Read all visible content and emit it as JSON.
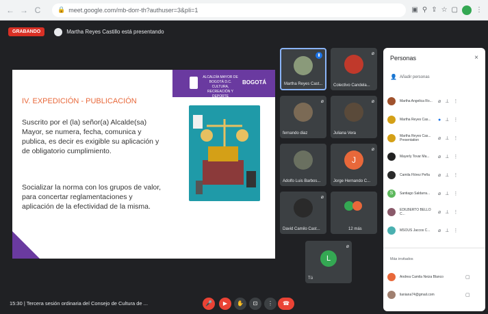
{
  "browser": {
    "url": "meet.google.com/mb-dorr-th?authuser=3&pli=1",
    "nav_back": "←",
    "nav_forward": "→",
    "nav_reload": "C",
    "lock": "🔒"
  },
  "meet": {
    "recording_label": "GRABANDO",
    "presenting_text": "Martha Reyes Castillo está presentando"
  },
  "slide": {
    "title": "IV. EXPEDICIÓN - PUBLICACIÓN",
    "paragraph1": "Suscrito por el (la) señor(a) Alcalde(sa) Mayor, se numera, fecha, comunica y publica, es decir es exigible su aplicación y de obligatorio cumplimiento.",
    "paragraph2": "Socializar la norma con los grupos de valor, para concertar reglamentaciones y aplicación de la efectividad de la misma.",
    "logo_text": "ALCALDÍA MAYOR DE BOGOTÁ D.C. CULTURA, RECREACIÓN Y DEPORTE",
    "logo_bogota": "BOGOTÁ"
  },
  "tiles": [
    {
      "name": "Martha Reyes Cast...",
      "avatar_color": "#8a9a7a"
    },
    {
      "name": "Colectivo Candela...",
      "avatar_color": "#c0392b"
    },
    {
      "name": "fernando diaz",
      "avatar_color": "#7b6a55"
    },
    {
      "name": "Juliana Vera",
      "avatar_color": "#5a4a3a"
    },
    {
      "name": "Adolfo Luis Barbos...",
      "avatar_color": "#6a7060"
    },
    {
      "name": "Jorge Hernando C...",
      "avatar_color": "#e8683a",
      "initial": "J"
    },
    {
      "name": "David Camilo Cast...",
      "avatar_color": "#2a2a2a"
    },
    {
      "name": "12 más",
      "avatar_color": "#e8683a"
    },
    {
      "name": "Tú",
      "avatar_color": "#34a853",
      "initial": "L"
    }
  ],
  "bottom": {
    "meeting_info": "15:30  |  Tercera sesión ordinaria del Consejo de Cultura de ..."
  },
  "panel": {
    "title": "Personas",
    "close": "×",
    "add_people": "Añadir personas",
    "in_call_label": "",
    "invited_label": "Más invitados",
    "people": [
      {
        "name": "Martha Angelica Ro...",
        "color": "#a0522d"
      },
      {
        "name": "Martha Reyes Cas...",
        "color": "#d4a017"
      },
      {
        "name": "Martha Reyes Cas... Presentation",
        "color": "#d4a017"
      },
      {
        "name": "Mayerly Tovar Ma...",
        "color": "#222222"
      },
      {
        "name": "Camila Flórez Peña",
        "color": "#2a2a2a"
      },
      {
        "name": "Santiago Saldarra...",
        "color": "#5cb85c",
        "initial": "S"
      },
      {
        "name": "EDILBERTO BELLO C...",
        "color": "#8a5a6a"
      },
      {
        "name": "MSOUS Jaccos C...",
        "color": "#4ab0b0"
      }
    ],
    "invited": [
      {
        "name": "Andrea Camila Neiza Blanco",
        "color": "#e8683a"
      },
      {
        "name": "lianiana74@gmail.com",
        "color": "#a08070"
      }
    ]
  }
}
